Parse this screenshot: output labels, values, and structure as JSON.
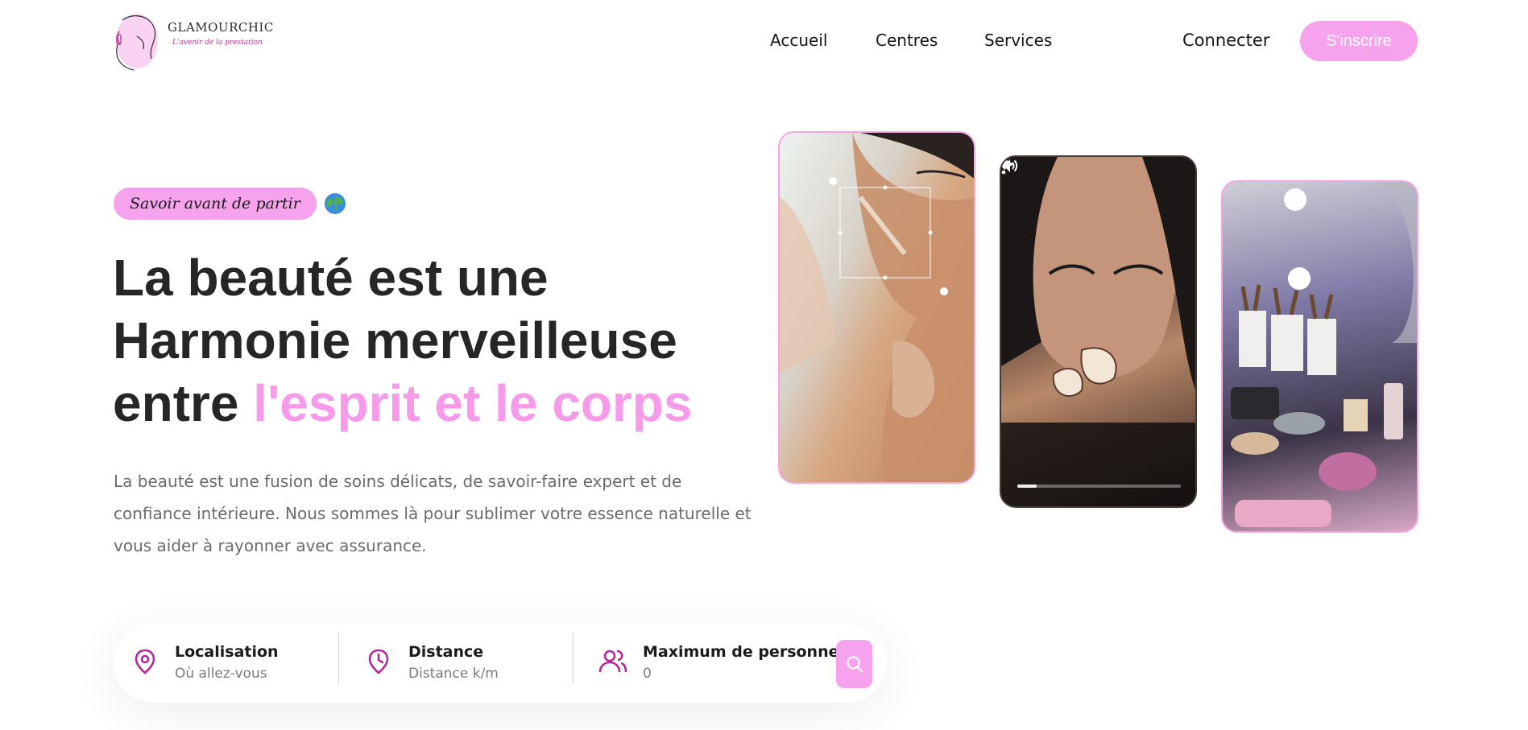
{
  "brand": {
    "name": "GLAMOURCHIC",
    "tagline": "L'avenir de la prestation"
  },
  "nav": {
    "items": [
      "Accueil",
      "Centres",
      "Services"
    ]
  },
  "auth": {
    "login": "Connecter",
    "signup": "S'inscrire"
  },
  "hero": {
    "badge": "Savoir avant de partir",
    "headline_line1": "La beauté est une",
    "headline_line2": "Harmonie merveilleuse",
    "headline_line3_plain": "entre ",
    "headline_line3_accent": "l'esprit et le corps",
    "description": "La beauté est une fusion de soins délicats, de savoir-faire expert et de confiance intérieure. Nous sommes là pour sublimer votre essence naturelle et vous aider à rayonner avec assurance."
  },
  "search": {
    "fields": [
      {
        "title": "Localisation",
        "placeholder": "Où allez-vous",
        "icon": "location-pin-icon"
      },
      {
        "title": "Distance",
        "placeholder": "Distance k/m",
        "icon": "clock-pin-icon"
      },
      {
        "title": "Maximum de personne",
        "value": "0",
        "icon": "users-icon"
      }
    ],
    "button_icon": "search-icon"
  },
  "video": {
    "progress": 0.12
  },
  "colors": {
    "accent": "#f7a2ed",
    "accent_text": "#f79ae9",
    "icon": "#b4289b"
  }
}
